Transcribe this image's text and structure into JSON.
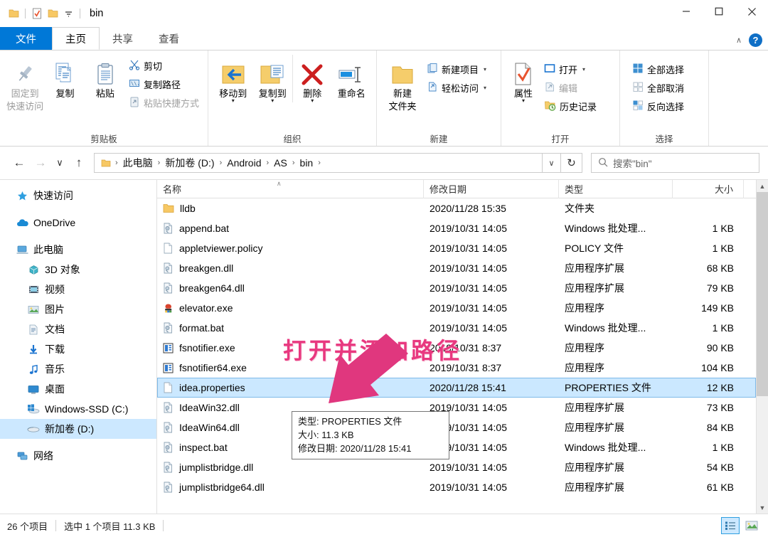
{
  "window": {
    "title": "bin",
    "quick_access": [
      "folder-icon",
      "properties-check-icon",
      "new-folder-icon",
      "customize-dropdown-icon"
    ],
    "controls": {
      "minimize": "—",
      "maximize": "☐",
      "close": "✕"
    }
  },
  "tabs": [
    {
      "label": "文件",
      "kind": "file"
    },
    {
      "label": "主页",
      "kind": "active"
    },
    {
      "label": "共享",
      "kind": "normal"
    },
    {
      "label": "查看",
      "kind": "normal"
    }
  ],
  "ribbon_controls": {
    "collapse": "∧",
    "help": "?"
  },
  "ribbon": {
    "groups": [
      {
        "title": "剪贴板",
        "big": [
          {
            "label": "固定到\n快速访问",
            "line1": "固定到",
            "line2": "快速访问",
            "icon": "pin-icon",
            "dim": true
          },
          {
            "label": "复制",
            "line1": "复制",
            "line2": "",
            "icon": "copy-icon",
            "dim": false
          },
          {
            "label": "粘贴",
            "line1": "粘贴",
            "line2": "",
            "icon": "paste-icon",
            "dim": false
          }
        ],
        "small": [
          {
            "label": "剪切",
            "icon": "scissors-icon",
            "dim": false
          },
          {
            "label": "复制路径",
            "icon": "copy-path-icon",
            "dim": false
          },
          {
            "label": "粘贴快捷方式",
            "icon": "paste-shortcut-icon",
            "dim": true
          }
        ]
      },
      {
        "title": "组织",
        "big": [
          {
            "line1": "移动到",
            "line2": "",
            "icon": "move-to-icon",
            "dim": false,
            "caret": true
          },
          {
            "line1": "复制到",
            "line2": "",
            "icon": "copy-to-icon",
            "dim": false,
            "caret": true
          },
          {
            "line1": "删除",
            "line2": "",
            "icon": "delete-icon",
            "dim": false,
            "caret": true
          },
          {
            "line1": "重命名",
            "line2": "",
            "icon": "rename-icon",
            "dim": false,
            "caret": false
          }
        ],
        "small": []
      },
      {
        "title": "新建",
        "big": [
          {
            "line1": "新建",
            "line2": "文件夹",
            "icon": "new-folder-icon",
            "dim": false,
            "caret": false
          }
        ],
        "small": [
          {
            "label": "新建项目",
            "icon": "new-item-icon",
            "dim": false,
            "caret": true
          },
          {
            "label": "轻松访问",
            "icon": "easy-access-icon",
            "dim": false,
            "caret": true
          }
        ]
      },
      {
        "title": "打开",
        "big": [
          {
            "line1": "属性",
            "line2": "",
            "icon": "properties-icon",
            "dim": false,
            "caret": true
          }
        ],
        "small": [
          {
            "label": "打开",
            "icon": "open-icon",
            "dim": false,
            "caret": true
          },
          {
            "label": "编辑",
            "icon": "edit-icon",
            "dim": true
          },
          {
            "label": "历史记录",
            "icon": "history-icon",
            "dim": false
          }
        ]
      },
      {
        "title": "选择",
        "big": [],
        "small": [
          {
            "label": "全部选择",
            "icon": "select-all-icon",
            "dim": false
          },
          {
            "label": "全部取消",
            "icon": "select-none-icon",
            "dim": false
          },
          {
            "label": "反向选择",
            "icon": "invert-selection-icon",
            "dim": false
          }
        ]
      }
    ]
  },
  "navbar": {
    "back": "←",
    "forward": "→",
    "recent": "∨",
    "up": "↑",
    "breadcrumbs": [
      "此电脑",
      "新加卷 (D:)",
      "Android",
      "AS",
      "bin"
    ],
    "separator": "›",
    "dropdown": "∨",
    "refresh": "↻",
    "search_placeholder": "搜索\"bin\"",
    "search_value": ""
  },
  "sidebar": {
    "items": [
      {
        "label": "快速访问",
        "icon": "star-icon",
        "level": 0,
        "selected": false,
        "gap_after": true
      },
      {
        "label": "OneDrive",
        "icon": "cloud-icon",
        "level": 0,
        "selected": false,
        "gap_after": true
      },
      {
        "label": "此电脑",
        "icon": "computer-icon",
        "level": 0,
        "selected": false,
        "gap_after": false
      },
      {
        "label": "3D 对象",
        "icon": "3d-objects-icon",
        "level": 1,
        "selected": false,
        "gap_after": false
      },
      {
        "label": "视频",
        "icon": "videos-icon",
        "level": 1,
        "selected": false,
        "gap_after": false
      },
      {
        "label": "图片",
        "icon": "pictures-icon",
        "level": 1,
        "selected": false,
        "gap_after": false
      },
      {
        "label": "文档",
        "icon": "documents-icon",
        "level": 1,
        "selected": false,
        "gap_after": false
      },
      {
        "label": "下载",
        "icon": "downloads-icon",
        "level": 1,
        "selected": false,
        "gap_after": false
      },
      {
        "label": "音乐",
        "icon": "music-icon",
        "level": 1,
        "selected": false,
        "gap_after": false
      },
      {
        "label": "桌面",
        "icon": "desktop-icon",
        "level": 1,
        "selected": false,
        "gap_after": false
      },
      {
        "label": "Windows-SSD (C:)",
        "icon": "windows-drive-icon",
        "level": 1,
        "selected": false,
        "gap_after": false
      },
      {
        "label": "新加卷 (D:)",
        "icon": "drive-icon",
        "level": 1,
        "selected": true,
        "gap_after": true
      },
      {
        "label": "网络",
        "icon": "network-icon",
        "level": 0,
        "selected": false,
        "gap_after": false
      }
    ]
  },
  "filelist": {
    "columns": [
      "名称",
      "修改日期",
      "类型",
      "大小"
    ],
    "sort_indicator": "∧",
    "rows": [
      {
        "name": "lldb",
        "date": "2020/11/28 15:35",
        "type": "文件夹",
        "size": "",
        "icon": "folder-icon",
        "selected": false
      },
      {
        "name": "append.bat",
        "date": "2019/10/31 14:05",
        "type": "Windows 批处理...",
        "size": "1 KB",
        "icon": "bat-file-icon",
        "selected": false
      },
      {
        "name": "appletviewer.policy",
        "date": "2019/10/31 14:05",
        "type": "POLICY 文件",
        "size": "1 KB",
        "icon": "generic-file-icon",
        "selected": false
      },
      {
        "name": "breakgen.dll",
        "date": "2019/10/31 14:05",
        "type": "应用程序扩展",
        "size": "68 KB",
        "icon": "dll-file-icon",
        "selected": false
      },
      {
        "name": "breakgen64.dll",
        "date": "2019/10/31 14:05",
        "type": "应用程序扩展",
        "size": "79 KB",
        "icon": "dll-file-icon",
        "selected": false
      },
      {
        "name": "elevator.exe",
        "date": "2019/10/31 14:05",
        "type": "应用程序",
        "size": "149 KB",
        "icon": "exe-colored-icon",
        "selected": false
      },
      {
        "name": "format.bat",
        "date": "2019/10/31 14:05",
        "type": "Windows 批处理...",
        "size": "1 KB",
        "icon": "bat-file-icon",
        "selected": false
      },
      {
        "name": "fsnotifier.exe",
        "date": "2019/10/31 8:37",
        "type": "应用程序",
        "size": "90 KB",
        "icon": "exe-file-icon",
        "selected": false
      },
      {
        "name": "fsnotifier64.exe",
        "date": "2019/10/31 8:37",
        "type": "应用程序",
        "size": "104 KB",
        "icon": "exe-file-icon",
        "selected": false
      },
      {
        "name": "idea.properties",
        "date": "2020/11/28 15:41",
        "type": "PROPERTIES 文件",
        "size": "12 KB",
        "icon": "generic-file-icon",
        "selected": true
      },
      {
        "name": "IdeaWin32.dll",
        "date": "2019/10/31 14:05",
        "type": "应用程序扩展",
        "size": "73 KB",
        "icon": "dll-file-icon",
        "selected": false
      },
      {
        "name": "IdeaWin64.dll",
        "date": "2019/10/31 14:05",
        "type": "应用程序扩展",
        "size": "84 KB",
        "icon": "dll-file-icon",
        "selected": false
      },
      {
        "name": "inspect.bat",
        "date": "2019/10/31 14:05",
        "type": "Windows 批处理...",
        "size": "1 KB",
        "icon": "bat-file-icon",
        "selected": false
      },
      {
        "name": "jumplistbridge.dll",
        "date": "2019/10/31 14:05",
        "type": "应用程序扩展",
        "size": "54 KB",
        "icon": "dll-file-icon",
        "selected": false
      },
      {
        "name": "jumplistbridge64.dll",
        "date": "2019/10/31 14:05",
        "type": "应用程序扩展",
        "size": "61 KB",
        "icon": "dll-file-icon",
        "selected": false
      }
    ]
  },
  "tooltip": {
    "line1": "类型: PROPERTIES 文件",
    "line2": "大小: 11.3 KB",
    "line3": "修改日期: 2020/11/28 15:41"
  },
  "annotation": {
    "text": "打开并添加路径",
    "color": "#e8387f"
  },
  "statusbar": {
    "item_count": "26 个项目",
    "selection": "选中 1 个项目  11.3 KB",
    "views": [
      {
        "name": "details-view",
        "active": true
      },
      {
        "name": "large-icons-view",
        "active": false
      }
    ]
  }
}
